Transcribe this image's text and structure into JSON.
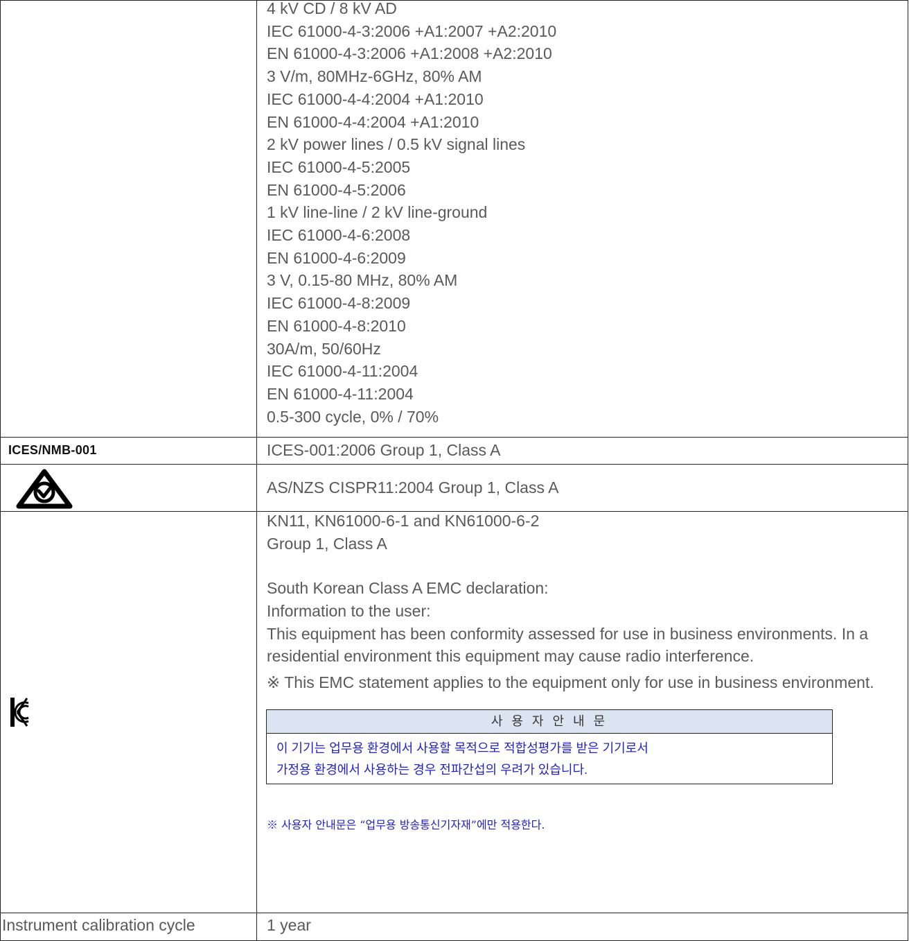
{
  "emc_lines": [
    "4 kV CD / 8 kV AD",
    "IEC 61000-4-3:2006 +A1:2007 +A2:2010",
    "EN 61000-4-3:2006 +A1:2008 +A2:2010",
    "3 V/m, 80MHz-6GHz, 80% AM",
    "IEC 61000-4-4:2004 +A1:2010",
    "EN 61000-4-4:2004 +A1:2010",
    "2 kV power lines / 0.5 kV signal lines",
    "IEC 61000-4-5:2005",
    "EN 61000-4-5:2006",
    "1 kV line-line / 2 kV line-ground",
    "IEC 61000-4-6:2008",
    "EN 61000-4-6:2009",
    "3 V, 0.15-80 MHz, 80% AM",
    "IEC 61000-4-8:2009",
    "EN 61000-4-8:2010",
    "30A/m, 50/60Hz",
    "IEC 61000-4-11:2004",
    "EN 61000-4-11:2004",
    "0.5-300 cycle, 0% / 70%"
  ],
  "ices": {
    "label": "ICES/NMB-001",
    "value": "ICES-001:2006 Group 1, Class A"
  },
  "rcm": {
    "icon": "rcm-mark-icon",
    "value": "AS/NZS CISPR11:2004 Group 1, Class A"
  },
  "kc": {
    "icon": "kc-mark-icon",
    "line1": "KN11, KN61000-6-1 and KN61000-6-2",
    "line2": "Group 1, Class A",
    "decl_title": "South Korean Class A EMC declaration:",
    "info": "Information to the user:",
    "paragraph": "This equipment has been conformity assessed for use in business environments. In a residential environment this equipment may cause radio interference.",
    "note": "※ This EMC statement applies to the equipment only for use in business environment.",
    "box_title": "사 용 자 안 내 문",
    "box_line1": "이 기기는 업무용 환경에서 사용할 목적으로 적합성평가를 받은 기기로서",
    "box_line2": "가정용 환경에서 사용하는 경우 전파간섭의 우려가 있습니다.",
    "korean_note": "※ 사용자 안내문은 “업무용 방송통신기자재”에만 적용한다."
  },
  "calibration": {
    "label": "Instrument calibration cycle",
    "value": "1 year"
  },
  "colors": {
    "text": "#595959",
    "korean_blue": "#1f1fcc",
    "box_header_bg": "#dbe5f1"
  }
}
